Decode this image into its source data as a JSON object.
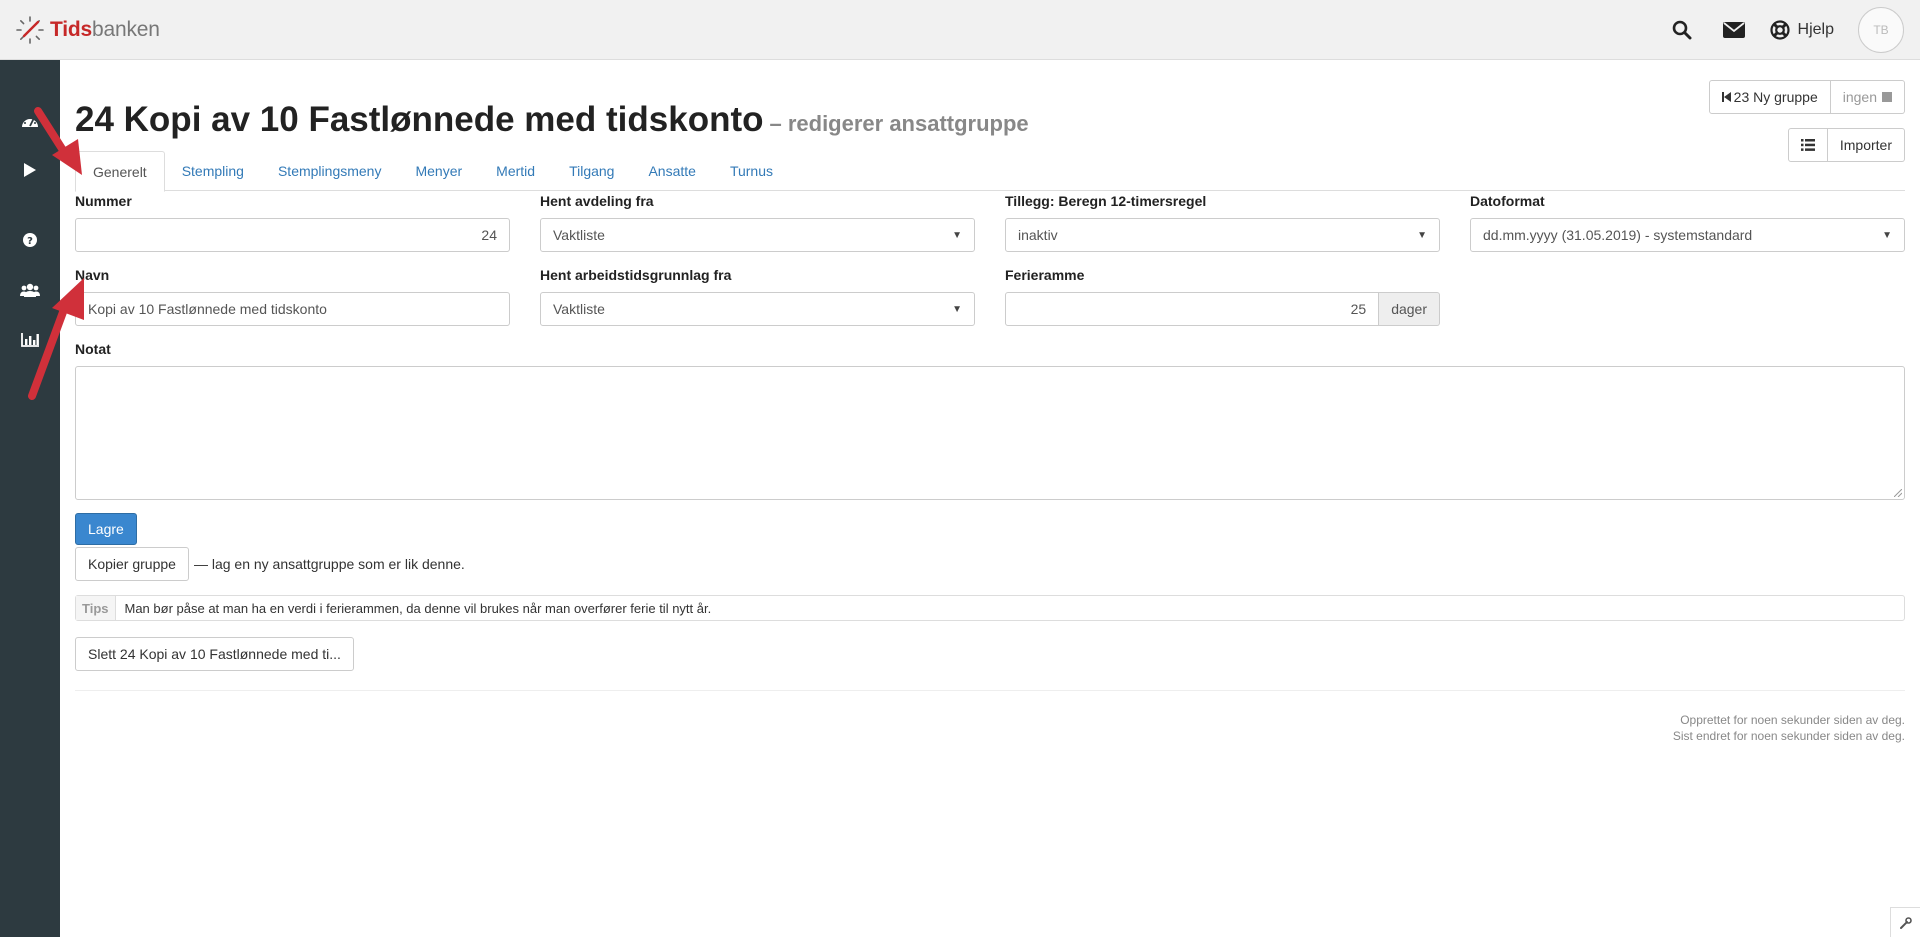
{
  "app": {
    "logo_red": "Tids",
    "logo_grey": "banken"
  },
  "header": {
    "help_label": "Hjelp",
    "avatar_initials": "TB"
  },
  "page": {
    "title": "24 Kopi av 10 Fastlønnede med tidskonto",
    "subtitle": "– redigerer ansattgruppe"
  },
  "nav_buttons": {
    "prev_label": "23 Ny gruppe",
    "next_label": "ingen",
    "import_label": "Importer"
  },
  "tabs": [
    {
      "label": "Generelt"
    },
    {
      "label": "Stempling"
    },
    {
      "label": "Stemplingsmeny"
    },
    {
      "label": "Menyer"
    },
    {
      "label": "Mertid"
    },
    {
      "label": "Tilgang"
    },
    {
      "label": "Ansatte"
    },
    {
      "label": "Turnus"
    }
  ],
  "form": {
    "nummer": {
      "label": "Nummer",
      "value": "24"
    },
    "navn": {
      "label": "Navn",
      "value": "Kopi av 10 Fastlønnede med tidskonto"
    },
    "hent_avdeling": {
      "label": "Hent avdeling fra",
      "value": "Vaktliste"
    },
    "hent_arbeidstid": {
      "label": "Hent arbeidstidsgrunnlag fra",
      "value": "Vaktliste"
    },
    "tillegg": {
      "label": "Tillegg: Beregn 12-timersregel",
      "value": "inaktiv"
    },
    "ferieramme": {
      "label": "Ferieramme",
      "value": "25",
      "addon": "dager"
    },
    "datoformat": {
      "label": "Datoformat",
      "value": "dd.mm.yyyy (31.05.2019) - systemstandard"
    },
    "notat": {
      "label": "Notat",
      "value": ""
    }
  },
  "actions": {
    "save_label": "Lagre",
    "copy_label": "Kopier gruppe",
    "copy_hint": "— lag en ny ansattgruppe som er lik denne.",
    "delete_label": "Slett 24 Kopi av 10 Fastlønnede med ti..."
  },
  "tips": {
    "label": "Tips",
    "text": "Man bør påse at man ha en verdi i ferierammen, da denne vil brukes når man overfører ferie til nytt år."
  },
  "meta": {
    "created": "Opprettet for noen sekunder siden av deg.",
    "modified": "Sist endret for noen sekunder siden av deg."
  },
  "colors": {
    "sidebar": "#2d3a40",
    "link": "#337ab7",
    "primary": "#3a87cf",
    "brand_red": "#c62828",
    "annotation_arrow": "#d0303a"
  }
}
